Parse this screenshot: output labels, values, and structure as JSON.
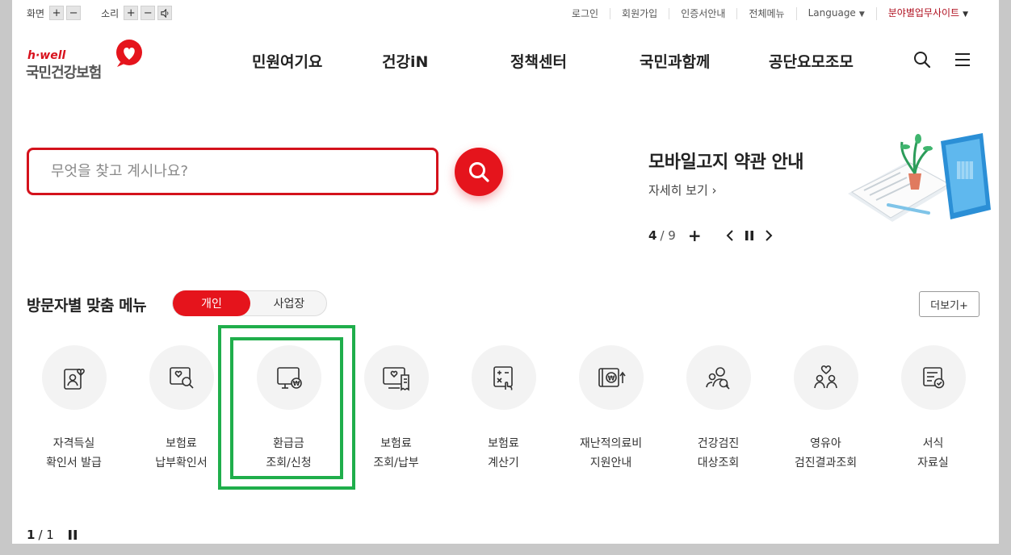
{
  "utility": {
    "screen_label": "화면",
    "sound_label": "소리",
    "plus": "+",
    "minus": "−",
    "links": [
      {
        "label": "로그인"
      },
      {
        "label": "회원가입"
      },
      {
        "label": "인증서안내"
      },
      {
        "label": "전체메뉴"
      },
      {
        "label": "Language"
      },
      {
        "label": "분야별업무사이트"
      }
    ]
  },
  "logo": {
    "en": "h·well",
    "kr": "국민건강보험"
  },
  "gnb": {
    "items": [
      "민원여기요",
      "건강iN",
      "정책센터",
      "국민과함께",
      "공단요모조모"
    ]
  },
  "search": {
    "placeholder": "무엇을 찾고 계시나요?"
  },
  "banner": {
    "title": "모바일고지 약관 안내",
    "more": "자세히 보기 ›",
    "current": "4",
    "total": "/ 9",
    "plus": "+"
  },
  "visitor": {
    "title": "방문자별 맞춤 메뉴",
    "tab_personal": "개인",
    "tab_business": "사업장",
    "more": "더보기+"
  },
  "menu_items": [
    {
      "l1": "자격득실",
      "l2": "확인서 발급",
      "icon": "person-card-icon"
    },
    {
      "l1": "보험료",
      "l2": "납부확인서",
      "icon": "search-document-icon"
    },
    {
      "l1": "환급금",
      "l2": "조회/신청",
      "icon": "monitor-refund-icon"
    },
    {
      "l1": "보험료",
      "l2": "조회/납부",
      "icon": "monitor-receipt-icon"
    },
    {
      "l1": "보험료",
      "l2": "계산기",
      "icon": "calculator-icon"
    },
    {
      "l1": "재난적의료비",
      "l2": "지원안내",
      "icon": "money-support-icon"
    },
    {
      "l1": "건강검진",
      "l2": "대상조회",
      "icon": "people-search-icon"
    },
    {
      "l1": "영유아",
      "l2": "검진결과조회",
      "icon": "family-heart-icon"
    },
    {
      "l1": "서식",
      "l2": "자료실",
      "icon": "form-check-icon"
    }
  ],
  "pager": {
    "current": "1",
    "total": "/ 1"
  },
  "colors": {
    "brand_red": "#e5141c",
    "highlight_green": "#1fae4b"
  }
}
